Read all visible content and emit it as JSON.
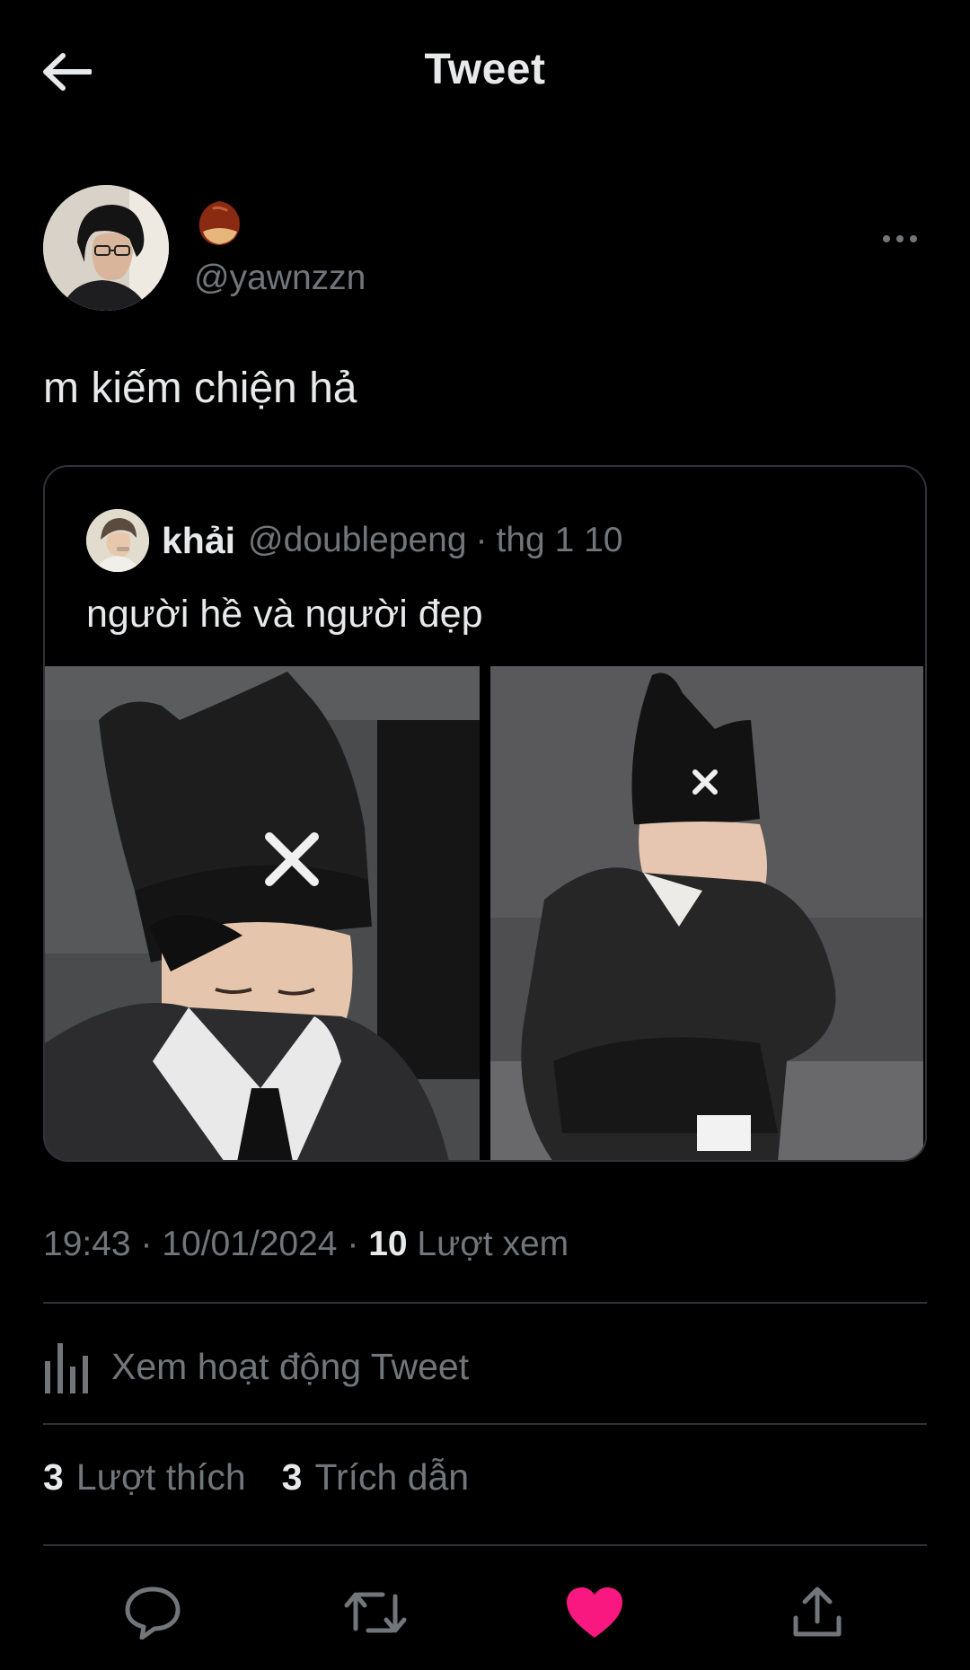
{
  "header": {
    "title": "Tweet",
    "back_icon": "arrow-left-icon"
  },
  "author": {
    "display_name_emoji": "chestnut-emoji",
    "handle": "@yawnzzn"
  },
  "tweet": {
    "text": "m kiếm chiện hả"
  },
  "quoted_tweet": {
    "name": "khải",
    "handle": "@doublepeng",
    "separator": "·",
    "date": "thg 1 10",
    "text": "người hề và người đẹp",
    "media_count": 2
  },
  "meta": {
    "time": "19:43",
    "sep1": "·",
    "date": "10/01/2024",
    "sep2": "·",
    "views_count": "10",
    "views_label": "Lượt xem"
  },
  "activity": {
    "label": "Xem hoạt động Tweet"
  },
  "stats": [
    {
      "count": "3",
      "label": "Lượt thích"
    },
    {
      "count": "3",
      "label": "Trích dẫn"
    }
  ],
  "colors": {
    "background": "#000000",
    "text_primary": "#e7e9ea",
    "text_secondary": "#71767b",
    "border": "#2f3336",
    "like_active": "#f91880"
  }
}
